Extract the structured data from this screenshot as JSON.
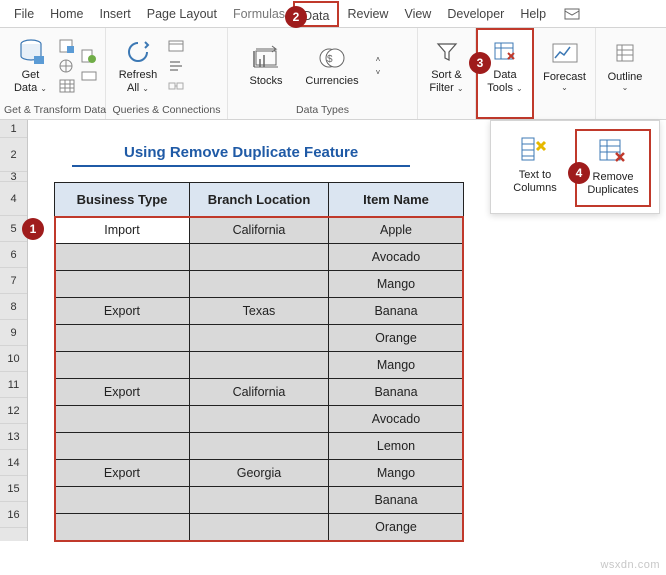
{
  "tabs": {
    "file": "File",
    "home": "Home",
    "insert": "Insert",
    "pagelayout": "Page Layout",
    "formulas": "Formulas",
    "data": "Data",
    "review": "Review",
    "view": "View",
    "developer": "Developer",
    "help": "Help"
  },
  "ribbon": {
    "get_data": {
      "label1": "Get",
      "label2": "Data",
      "group": "Get & Transform Data"
    },
    "refresh": {
      "label1": "Refresh",
      "label2": "All",
      "group": "Queries & Connections"
    },
    "stocks": "Stocks",
    "currencies": "Currencies",
    "datatypes_group": "Data Types",
    "sort_filter": {
      "label1": "Sort &",
      "label2": "Filter"
    },
    "data_tools": {
      "label1": "Data",
      "label2": "Tools"
    },
    "forecast": "Forecast",
    "outline": "Outline"
  },
  "dropdown": {
    "text_to_columns": {
      "l1": "Text to",
      "l2": "Columns"
    },
    "remove_duplicates": {
      "l1": "Remove",
      "l2": "Duplicates"
    }
  },
  "rows": [
    "1",
    "2",
    "3",
    "4",
    "5",
    "6",
    "7",
    "8",
    "9",
    "10",
    "11",
    "12",
    "13",
    "14",
    "15",
    "16"
  ],
  "title": "Using Remove Duplicate Feature",
  "headers": [
    "Business Type",
    "Branch Location",
    "Item Name"
  ],
  "data_rows": [
    [
      "Import",
      "California",
      "Apple"
    ],
    [
      "",
      "",
      "Avocado"
    ],
    [
      "",
      "",
      "Mango"
    ],
    [
      "Export",
      "Texas",
      "Banana"
    ],
    [
      "",
      "",
      "Orange"
    ],
    [
      "",
      "",
      "Mango"
    ],
    [
      "Export",
      "California",
      "Banana"
    ],
    [
      "",
      "",
      "Avocado"
    ],
    [
      "",
      "",
      "Lemon"
    ],
    [
      "Export",
      "Georgia",
      "Mango"
    ],
    [
      "",
      "",
      "Banana"
    ],
    [
      "",
      "",
      "Orange"
    ]
  ],
  "badges": {
    "b1": "1",
    "b2": "2",
    "b3": "3",
    "b4": "4"
  },
  "watermark": "wsxdn.com",
  "chevron": "⌄"
}
